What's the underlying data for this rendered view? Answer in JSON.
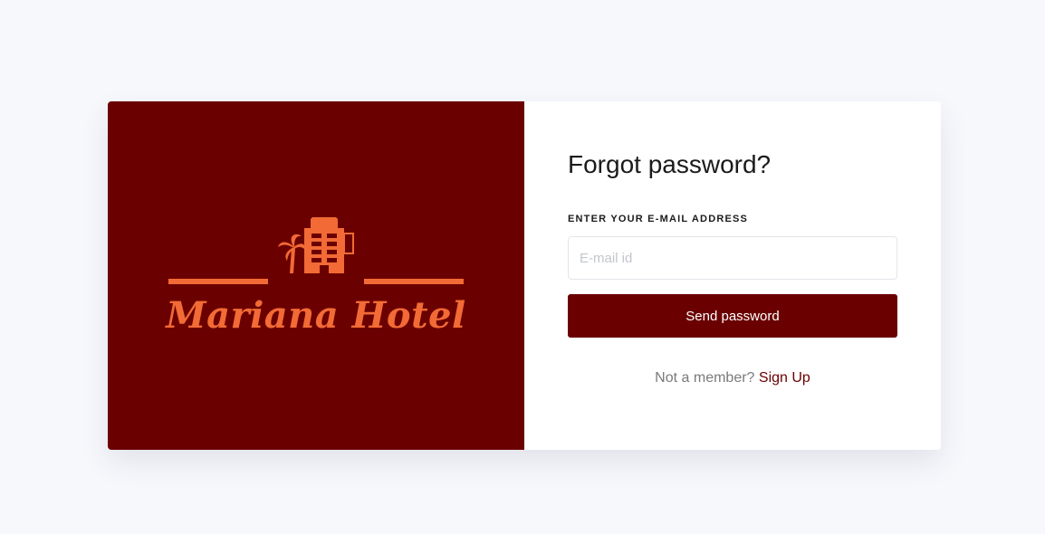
{
  "brand": {
    "name": "Mariana Hotel",
    "panel_color": "#6b0000",
    "logo_color": "#f26a35",
    "logo_icon": "hotel-building-palm-icon"
  },
  "form": {
    "title": "Forgot password?",
    "email_label": "ENTER YOUR E-MAIL ADDRESS",
    "email_value": "",
    "email_placeholder": "E-mail id",
    "submit_label": "Send password",
    "signup_prompt": "Not a member?",
    "signup_link": "Sign Up",
    "accent_color": "#6b0000"
  }
}
